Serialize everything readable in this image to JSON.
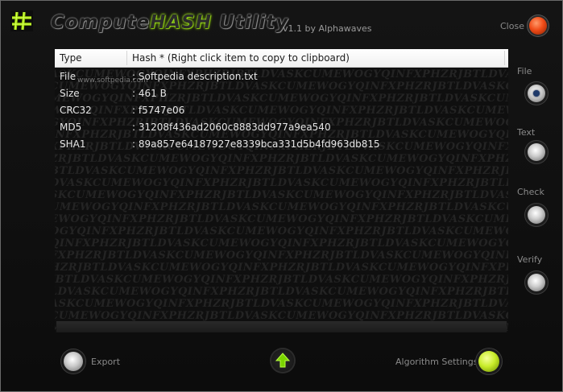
{
  "header": {
    "logo_icon": "hash-logo-icon",
    "title_prefix": "Compute",
    "title_highlight": "HASH",
    "title_suffix": " Utility",
    "version": "v1.1 by Alphawaves",
    "close_label": "Close",
    "close_color": "#f04c18"
  },
  "table": {
    "col_type": "Type",
    "col_hash": "Hash * (Right click item to copy to clipboard)",
    "rows": [
      {
        "key": "File",
        "value": ": Softpedia description.txt"
      },
      {
        "key": "Size",
        "value": ": 461 B"
      },
      {
        "key": "CRC32",
        "value": ": f5747e06"
      },
      {
        "key": "MD5",
        "value": ": 31208f436ad2060c8883dd977a9ea540"
      },
      {
        "key": "SHA1",
        "value": ": 89a857e64187927e8339bca331d5b4fd963db815"
      }
    ],
    "watermark": "www.softpedia.com"
  },
  "options": {
    "file": "File",
    "text": "Text",
    "check": "Check",
    "verify": "Verify",
    "selected": "file"
  },
  "bottom": {
    "export_label": "Export",
    "up_icon": "up-arrow-icon",
    "algorithm_label": "Algorithm Settings",
    "accent": "#c8ec2a"
  }
}
